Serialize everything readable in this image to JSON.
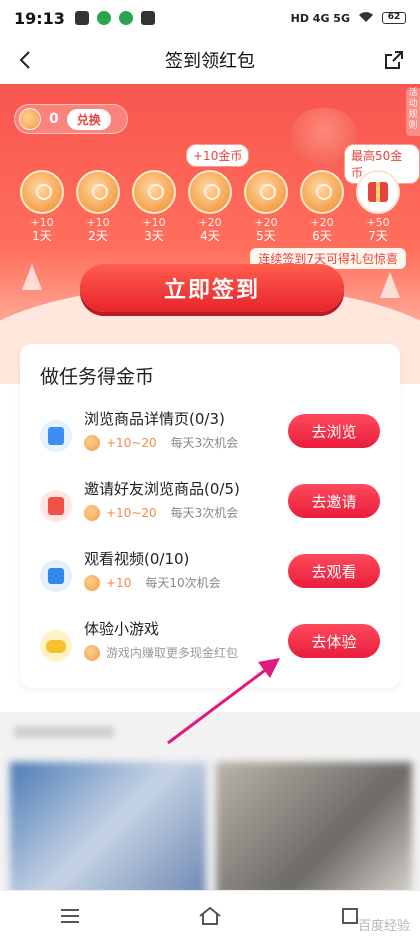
{
  "status_bar": {
    "time": "19:13",
    "network": "HD 4G 5G",
    "battery": "62"
  },
  "nav": {
    "title": "签到领红包"
  },
  "hero": {
    "coin_count": "0",
    "exchange_label": "兑换",
    "side_tag": "活动规则",
    "callout_plus10": "+10金币",
    "callout_max": "最高50金币",
    "days": [
      {
        "bonus": "+10",
        "label": "1天",
        "type": "coin"
      },
      {
        "bonus": "+10",
        "label": "2天",
        "type": "coin"
      },
      {
        "bonus": "+10",
        "label": "3天",
        "type": "coin"
      },
      {
        "bonus": "+20",
        "label": "4天",
        "type": "coin"
      },
      {
        "bonus": "+20",
        "label": "5天",
        "type": "coin"
      },
      {
        "bonus": "+20",
        "label": "6天",
        "type": "coin"
      },
      {
        "bonus": "+50",
        "label": "7天",
        "type": "gift"
      }
    ],
    "streak_tip": "连续签到7天可得礼包惊喜",
    "signin_label": "立即签到"
  },
  "tasks": {
    "title": "做任务得金币",
    "items": [
      {
        "name": "浏览商品详情页(0/3)",
        "reward": "+10~20",
        "limit": "每天3次机会",
        "button": "去浏览",
        "icon": "browse-icon"
      },
      {
        "name": "邀请好友浏览商品(0/5)",
        "reward": "+10~20",
        "limit": "每天3次机会",
        "button": "去邀请",
        "icon": "invite-icon"
      },
      {
        "name": "观看视频(0/10)",
        "reward": "+10",
        "limit": "每天10次机会",
        "button": "去观看",
        "icon": "video-icon"
      },
      {
        "name": "体验小游戏",
        "reward": "游戏内赚取更多现金红包",
        "limit": "",
        "button": "去体验",
        "icon": "game-icon"
      }
    ]
  },
  "watermark": "百度经验",
  "colors": {
    "accent_red": "#e8443f",
    "button_red": "#e81d3c",
    "annotation_arrow": "#e0197d"
  }
}
